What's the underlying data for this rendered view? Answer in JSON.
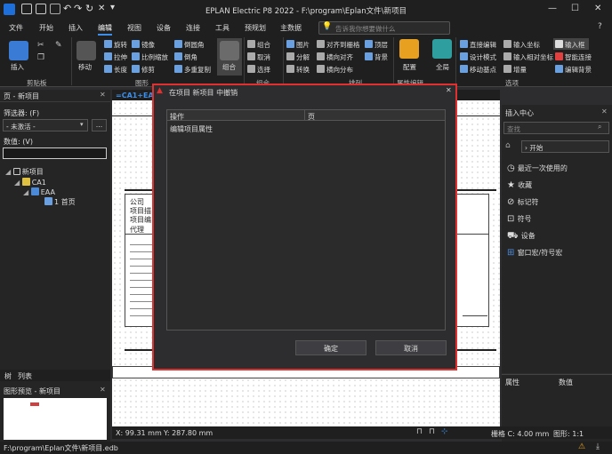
{
  "app": {
    "title": "EPLAN Electric P8 2022 - F:\\program\\Eplan文件\\新项目"
  },
  "menu": {
    "items": [
      "文件",
      "开始",
      "插入",
      "编辑",
      "视图",
      "设备",
      "连接",
      "工具",
      "预规划",
      "主数据"
    ],
    "active_index": 3
  },
  "search": {
    "placeholder": "告诉我你想要做什么"
  },
  "ribbon": {
    "clipboard": {
      "label": "剪贴板",
      "insert": "插入"
    },
    "graphics": {
      "label": "图形",
      "move": "移动",
      "rotate": "旋转",
      "mirror": "镜像",
      "round": "倒圆角",
      "stretch": "拉伸",
      "scale": "比例缩放",
      "chamfer": "倒角",
      "length": "长度",
      "trim": "修剪",
      "multi_copy": "多重复制",
      "group": "组合"
    },
    "group_sec": {
      "label": "组合",
      "group": "组合",
      "ungroup": "取消",
      "select": "选择"
    },
    "arrange": {
      "label": "排列",
      "image": "图片",
      "decompose": "分解",
      "convert": "转换",
      "align_grid": "对齐到栅格",
      "h_align": "横向对齐",
      "h_dist": "横向分布",
      "top": "顶层",
      "back": "背景"
    },
    "config": "配置",
    "global": "全局",
    "other_label": "属性编辑",
    "options": {
      "label": "选项",
      "direct_edit": "直接编辑",
      "design_mode": "设计模式",
      "move_base": "移动基点",
      "input_coord": "输入坐标",
      "input_rel": "输入相对坐标",
      "increment": "增量",
      "input_box": "输入框",
      "smart_conn": "智能连接",
      "edit_back": "编辑背景"
    }
  },
  "left_panel": {
    "title": "页 - 新项目",
    "filter_label": "筛选器: (F)",
    "filter_value": "- 未激活 -",
    "value_label": "数值: (V)",
    "tree": [
      {
        "label": "新项目"
      },
      {
        "label": "CA1"
      },
      {
        "label": "EAA"
      },
      {
        "label": "1 首页"
      }
    ],
    "tabs": [
      "树",
      "列表"
    ],
    "preview_title": "图形预览 - 新项目"
  },
  "doc_tab": {
    "label": "=CA1+EAA"
  },
  "title_block": {
    "line1": "公司",
    "line2": "项目描",
    "line3": "项目编",
    "line4": "代理"
  },
  "dialog": {
    "title": "在项目 新项目 中撤销",
    "columns": [
      "操作",
      "页"
    ],
    "rows": [
      {
        "op": "编辑项目属性",
        "page": ""
      }
    ],
    "ok": "确定",
    "cancel": "取消"
  },
  "right_panel": {
    "title": "插入中心",
    "search_placeholder": "查找",
    "nav_start": "开始",
    "items": [
      {
        "label": "最近一次使用的",
        "icon": "clock-icon"
      },
      {
        "label": "收藏",
        "icon": "star-icon"
      },
      {
        "label": "标记符",
        "icon": "tag-icon"
      },
      {
        "label": "符号",
        "icon": "symbol-icon"
      },
      {
        "label": "设备",
        "icon": "cart-icon"
      },
      {
        "label": "窗口宏/符号宏",
        "icon": "macro-icon"
      }
    ],
    "props_col1": "属性",
    "props_col2": "数值"
  },
  "status": {
    "x": "X: 99.31 mm",
    "y": "Y: 287.80 mm",
    "grid": "栅格 C: 4.00 mm",
    "scale": "图形: 1:1",
    "path": "F:\\program\\Eplan文件\\新项目.edb"
  }
}
